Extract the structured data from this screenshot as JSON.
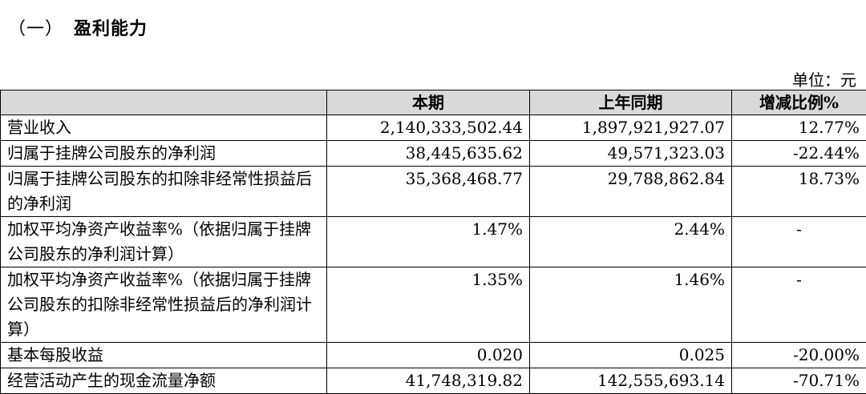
{
  "section": {
    "number": "（一）",
    "title": "盈利能力"
  },
  "unit_label": "单位：元",
  "table": {
    "headers": [
      "",
      "本期",
      "上年同期",
      "增减比例%"
    ],
    "rows": [
      {
        "label": "营业收入",
        "current": "2,140,333,502.44",
        "previous": "1,897,921,927.07",
        "change": "12.77%"
      },
      {
        "label": "归属于挂牌公司股东的净利润",
        "current": "38,445,635.62",
        "previous": "49,571,323.03",
        "change": "-22.44%"
      },
      {
        "label": "归属于挂牌公司股东的扣除非经常性损益后的净利润",
        "current": "35,368,468.77",
        "previous": "29,788,862.84",
        "change": "18.73%"
      },
      {
        "label": "加权平均净资产收益率%（依据归属于挂牌公司股东的净利润计算）",
        "current": "1.47%",
        "previous": "2.44%",
        "change": "-"
      },
      {
        "label": "加权平均净资产收益率%（依据归属于挂牌公司股东的扣除非经常性损益后的净利润计算）",
        "current": "1.35%",
        "previous": "1.46%",
        "change": "-"
      },
      {
        "label": "基本每股收益",
        "current": "0.020",
        "previous": "0.025",
        "change": "-20.00%"
      },
      {
        "label": "经营活动产生的现金流量净额",
        "current": "41,748,319.82",
        "previous": "142,555,693.14",
        "change": "-70.71%"
      }
    ]
  }
}
